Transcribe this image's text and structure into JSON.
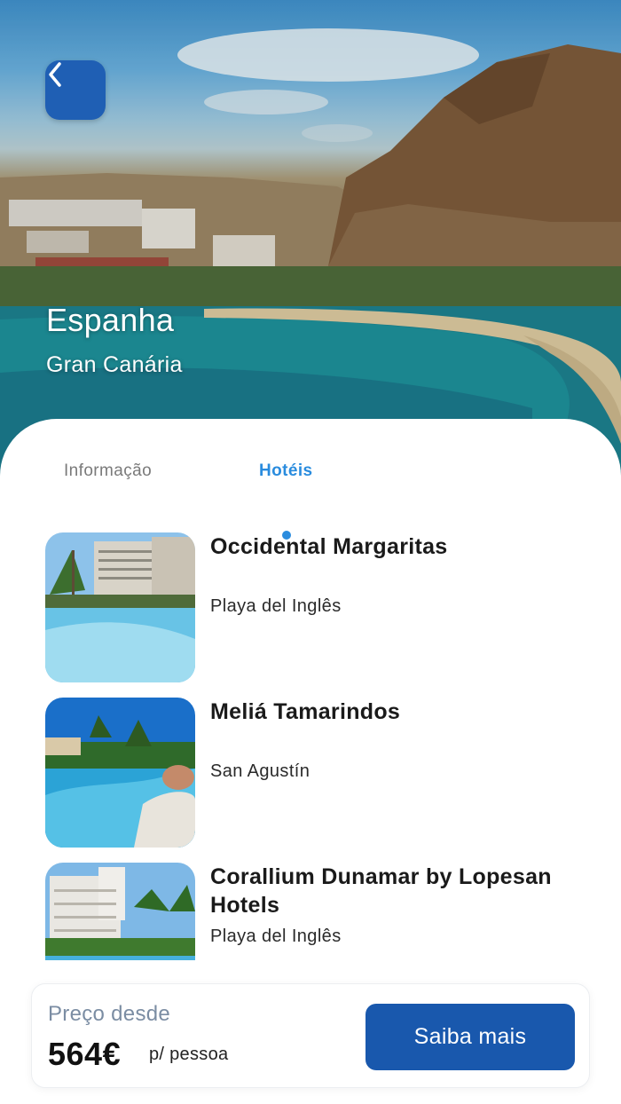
{
  "hero": {
    "country": "Espanha",
    "region": "Gran Canária",
    "back_icon": "chevron-left-icon"
  },
  "tabs": [
    {
      "label": "Informação",
      "active": false
    },
    {
      "label": "Hotéis",
      "active": true
    }
  ],
  "hotels": [
    {
      "name": "Occidental Margaritas",
      "location": "Playa del Inglês"
    },
    {
      "name": " Meliá Tamarindos",
      "location": " San Agustín"
    },
    {
      "name": " Corallium Dunamar by Lopesan Hotels",
      "location": " Playa del Inglês"
    }
  ],
  "price_bar": {
    "label": "Preço desde",
    "value": "564€",
    "unit": "p/ pessoa",
    "button_label": "Saiba mais"
  },
  "colors": {
    "primary": "#1958ad",
    "accent": "#2a8cde",
    "muted": "#7b8da3"
  }
}
